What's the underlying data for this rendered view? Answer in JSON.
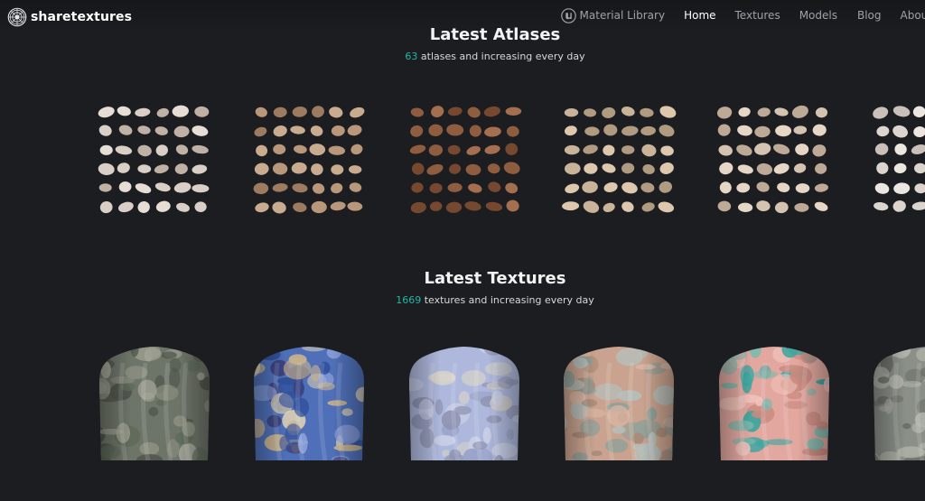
{
  "brand": {
    "name": "sharetextures"
  },
  "nav": {
    "items": [
      {
        "label": "Material Library",
        "icon": "unreal-engine-icon"
      },
      {
        "label": "Home",
        "active": true
      },
      {
        "label": "Textures"
      },
      {
        "label": "Models"
      },
      {
        "label": "Blog"
      },
      {
        "label": "About"
      }
    ]
  },
  "atlases": {
    "title": "Latest Atlases",
    "count": "63",
    "subtitle_rest": " atlases and increasing every day",
    "cards": [
      {
        "palette": [
          "#d9cfc6",
          "#bfb1a6",
          "#e6ddd5"
        ]
      },
      {
        "palette": [
          "#b8977a",
          "#9c7b60",
          "#c9ab8f"
        ]
      },
      {
        "palette": [
          "#8e5c3e",
          "#76482f",
          "#a46f4e"
        ]
      },
      {
        "palette": [
          "#c9b49a",
          "#b09a80",
          "#ddc8ad"
        ]
      },
      {
        "palette": [
          "#d5c3b1",
          "#bda996",
          "#e6d6c6"
        ]
      },
      {
        "palette": [
          "#dcd5cf",
          "#c8c0b9",
          "#ece6e1"
        ]
      }
    ]
  },
  "textures": {
    "title": "Latest Textures",
    "count": "1669",
    "subtitle_rest": " textures and increasing every day",
    "cards": [
      {
        "base": "#6d7468",
        "patches": [
          "#8c9182",
          "#4f554c",
          "#a3a597",
          "#5f6b5a"
        ]
      },
      {
        "base": "#4f6fb8",
        "patches": [
          "#2f4f9a",
          "#c7b28c",
          "#8aa0d9",
          "#e0d2b4",
          "#3a3f7a"
        ]
      },
      {
        "base": "#aeb8dc",
        "patches": [
          "#c9cfe6",
          "#8f94b3",
          "#d8d4c9",
          "#9aa3c9"
        ]
      },
      {
        "base": "#c9a38f",
        "patches": [
          "#8fa09a",
          "#d9b6a3",
          "#a88a78",
          "#b5c0bd"
        ]
      },
      {
        "base": "#e2a79f",
        "patches": [
          "#3aa6a0",
          "#c98a7f",
          "#f0c1b9",
          "#7fb9ad"
        ]
      },
      {
        "base": "#8a8f88",
        "patches": [
          "#b0b3aa",
          "#6a6f67"
        ]
      }
    ]
  }
}
